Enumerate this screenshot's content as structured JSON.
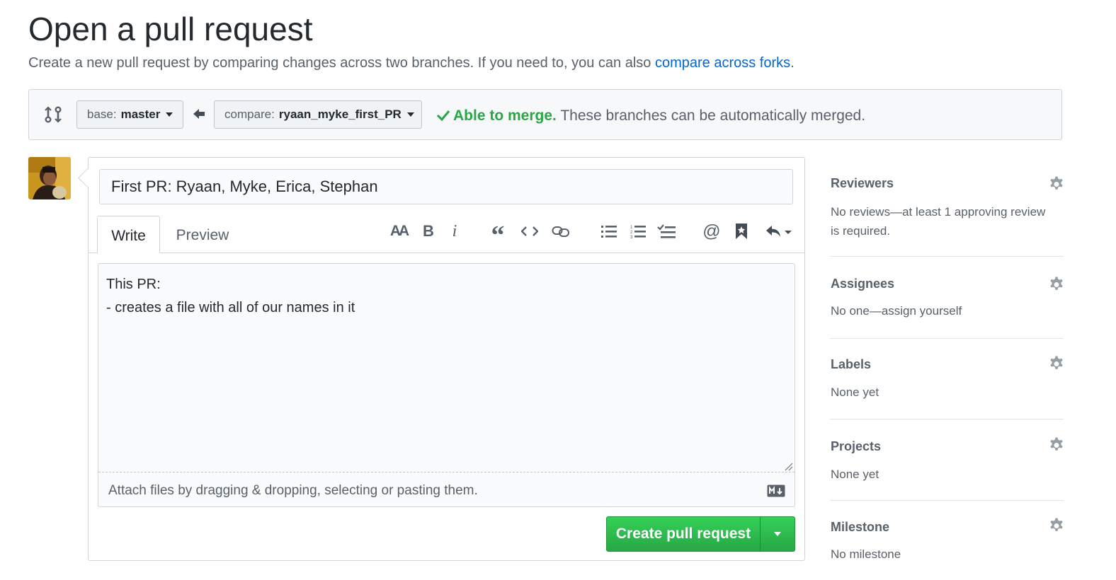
{
  "header": {
    "title": "Open a pull request",
    "subtitle_prefix": "Create a new pull request by comparing changes across two branches. If you need to, you can also ",
    "subtitle_link": "compare across forks",
    "subtitle_suffix": "."
  },
  "range": {
    "base_key": "base:",
    "base_value": "master",
    "compare_key": "compare:",
    "compare_value": "ryaan_myke_first_PR",
    "merge_ok": "Able to merge.",
    "merge_msg": " These branches can be automatically merged.",
    "status_color": "#28a745"
  },
  "form": {
    "title_value": "First PR: Ryaan, Myke, Erica, Stephan",
    "tabs": [
      "Write",
      "Preview"
    ],
    "toolbar": [
      "header-icon",
      "bold-icon",
      "italic-icon",
      "quote-icon",
      "code-icon",
      "link-icon",
      "bulleted-list-icon",
      "numbered-list-icon",
      "task-list-icon",
      "mention-icon",
      "reference-icon",
      "reply-icon"
    ],
    "body_value": "This PR:\n- creates a file with all of our names in it",
    "attach_hint": "Attach files by dragging & dropping, selecting or pasting them.",
    "submit_label": "Create pull request",
    "accent": "#2cbe4e"
  },
  "sidebar": {
    "sections": [
      {
        "heading": "Reviewers",
        "value": "No reviews—at least 1 approving review",
        "value2": "is required."
      },
      {
        "heading": "Assignees",
        "value": "No one—assign yourself"
      },
      {
        "heading": "Labels",
        "value": "None yet"
      },
      {
        "heading": "Projects",
        "value": "None yet"
      },
      {
        "heading": "Milestone",
        "value": "No milestone"
      }
    ]
  }
}
